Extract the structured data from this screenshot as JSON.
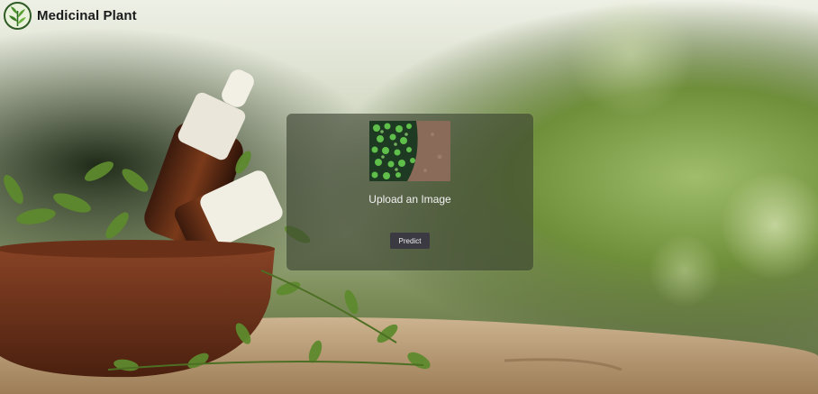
{
  "header": {
    "brand": "Medicinal Plant",
    "logo_icon": "leaf-logo-icon"
  },
  "upload": {
    "label": "Upload an Image",
    "preview_icon": "plant-photo-thumbnail"
  },
  "actions": {
    "predict_label": "Predict"
  },
  "colors": {
    "card_background": "#3a4230",
    "button_background": "#3b3942",
    "brand_text": "#1a1a1a"
  }
}
